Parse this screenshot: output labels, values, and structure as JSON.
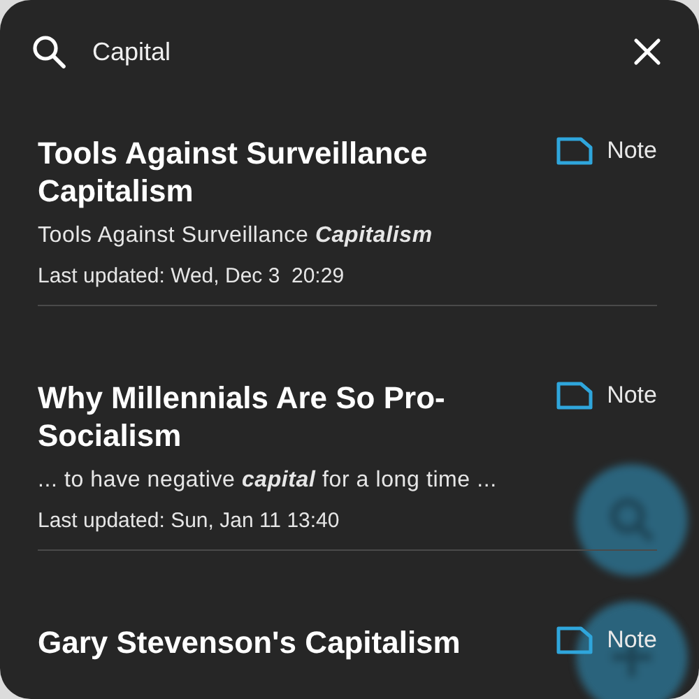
{
  "search": {
    "value": "Capital"
  },
  "results": [
    {
      "title": "Tools Against Surveillance Capitalism",
      "kind": "note",
      "type_label": "Note",
      "snippet": "Tools Against Surveillance **Capitalism**",
      "updated": "Last updated: Wed, Dec 3  20:29"
    },
    {
      "title": "Why Millennials Are So Pro-Socialism",
      "kind": "note",
      "type_label": "Note",
      "snippet": "... to have negative **capital** for a long time ...",
      "updated": "Last updated: Sun, Jan 11 13:40"
    },
    {
      "title": "Gary Stevenson's Capitalism",
      "kind": "note",
      "type_label": "Note"
    }
  ]
}
